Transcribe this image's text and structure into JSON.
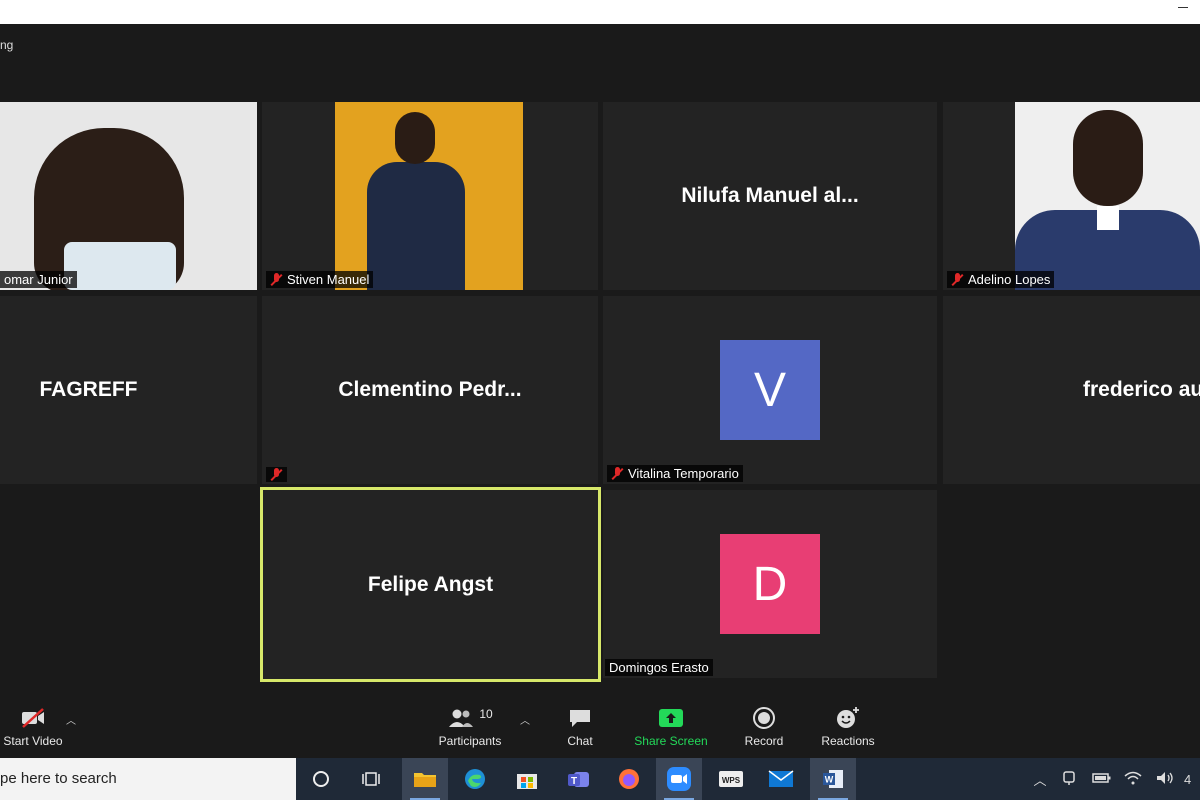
{
  "window": {
    "meeting_label": "ng"
  },
  "tiles": [
    {
      "id": "t1",
      "label": "omar Junior",
      "muted": false,
      "display": "video"
    },
    {
      "id": "t2",
      "label": "Stiven Manuel",
      "muted": true,
      "display": "video"
    },
    {
      "id": "t3",
      "label": "",
      "big_name": "Nilufa  Manuel  al...",
      "muted": false,
      "display": "name"
    },
    {
      "id": "t4",
      "label": "Adelino Lopes",
      "muted": true,
      "display": "video"
    },
    {
      "id": "t5",
      "label": "",
      "big_name": "FAGREFF",
      "muted": false,
      "display": "name"
    },
    {
      "id": "t6",
      "label": "",
      "big_name": "Clementino  Pedr...",
      "muted": true,
      "display": "name"
    },
    {
      "id": "t7",
      "label": "Vitalina Temporario",
      "avatar_letter": "V",
      "avatar_color": "#5468c5",
      "muted": true,
      "display": "avatar"
    },
    {
      "id": "t8",
      "label": "",
      "big_name": "frederico  aurelio...",
      "muted": false,
      "display": "name"
    },
    {
      "id": "t9",
      "label": "",
      "big_name": "Felipe Angst",
      "muted": false,
      "display": "name",
      "active_speaker": true
    },
    {
      "id": "t10",
      "label": "Domingos Erasto",
      "avatar_letter": "D",
      "avatar_color": "#e83e74",
      "muted": false,
      "display": "avatar"
    }
  ],
  "toolbar": {
    "start_video": "Start Video",
    "participants": "Participants",
    "participants_count": "10",
    "chat": "Chat",
    "share_screen": "Share Screen",
    "record": "Record",
    "reactions": "Reactions"
  },
  "taskbar": {
    "search_placeholder": "pe here to search",
    "apps": [
      "cortana-icon",
      "task-view-icon",
      "file-explorer-icon",
      "edge-icon",
      "store-icon",
      "teams-icon",
      "firefox-icon",
      "zoom-icon",
      "wps-icon",
      "mail-icon",
      "word-icon"
    ],
    "clock_fragment": "4"
  },
  "colors": {
    "accent_green": "#23d959",
    "active_border": "#d7e86a",
    "muted_red": "#e02828"
  }
}
